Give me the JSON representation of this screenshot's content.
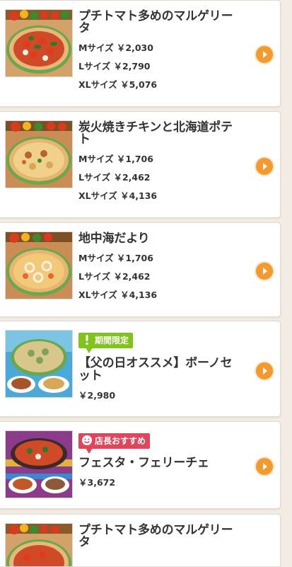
{
  "colors": {
    "accent_orange": "#f29a2e",
    "badge_limited_green": "#7fc31c",
    "badge_recommend_pink": "#e2445c",
    "background": "#f3ece4"
  },
  "menu": {
    "items": [
      {
        "name": "プチトマト多めのマルゲリータ",
        "image": "pizza-margherita",
        "prices": [
          "Mサイズ ￥2,030",
          "Lサイズ ￥2,790",
          "XLサイズ ￥5,076"
        ],
        "icon": "chevron-right-icon"
      },
      {
        "name": "炭火焼きチキンと北海道ポテト",
        "image": "pizza-chicken-potato",
        "prices": [
          "Mサイズ ￥1,706",
          "Lサイズ ￥2,462",
          "XLサイズ ￥4,136"
        ],
        "icon": "chevron-right-icon"
      },
      {
        "name": "地中海だより",
        "image": "pizza-mediterranean",
        "prices": [
          "Mサイズ ￥1,706",
          "Lサイズ ￥2,462",
          "XLサイズ ￥4,136"
        ],
        "icon": "chevron-right-icon"
      },
      {
        "badge": "期間限定",
        "badge_icon": "exclamation-icon",
        "name": "【父の日オススメ】ボーノセット",
        "image": "bono-set",
        "price": "￥2,980",
        "icon": "chevron-right-icon"
      },
      {
        "badge": "店長おすすめ",
        "badge_icon": "smiley-icon",
        "name": "フェスタ・フェリーチェ",
        "image": "festa-felice-set",
        "price": "￥3,672",
        "icon": "chevron-right-icon"
      },
      {
        "name": "プチトマト多めのマルゲリータ",
        "image": "pizza-margherita",
        "icon": "chevron-right-icon"
      }
    ]
  }
}
